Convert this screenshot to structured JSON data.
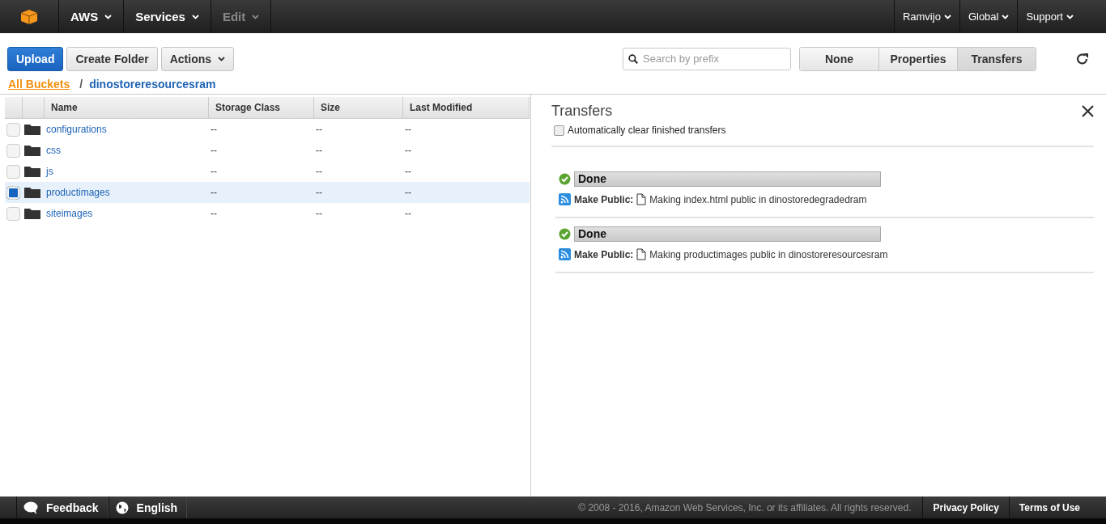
{
  "top_nav": {
    "left": [
      {
        "label": "AWS",
        "disabled": false
      },
      {
        "label": "Services",
        "disabled": false
      },
      {
        "label": "Edit",
        "disabled": true
      }
    ],
    "right": [
      "Ramvijo",
      "Global",
      "Support"
    ]
  },
  "toolbar": {
    "buttons": [
      {
        "label": "Upload",
        "kind": "primary"
      },
      {
        "label": "Create Folder",
        "kind": "plain"
      },
      {
        "label": "Actions",
        "kind": "menu"
      }
    ],
    "search": {
      "placeholder": "Search by prefix"
    },
    "views": [
      {
        "label": "None",
        "selected": false
      },
      {
        "label": "Properties",
        "selected": false
      },
      {
        "label": "Transfers",
        "selected": true
      }
    ]
  },
  "breadcrumb": {
    "root": "All Buckets",
    "separator": "/",
    "current": "dinostoreresourcesram"
  },
  "table": {
    "columns": [
      "Name",
      "Storage Class",
      "Size",
      "Last Modified"
    ],
    "rows": [
      {
        "name": "configurations",
        "storage_class": "--",
        "size": "--",
        "last_modified": "--",
        "selected": false
      },
      {
        "name": "css",
        "storage_class": "--",
        "size": "--",
        "last_modified": "--",
        "selected": false
      },
      {
        "name": "js",
        "storage_class": "--",
        "size": "--",
        "last_modified": "--",
        "selected": false
      },
      {
        "name": "productimages",
        "storage_class": "--",
        "size": "--",
        "last_modified": "--",
        "selected": true
      },
      {
        "name": "siteimages",
        "storage_class": "--",
        "size": "--",
        "last_modified": "--",
        "selected": false
      }
    ]
  },
  "transfers": {
    "title": "Transfers",
    "auto_clear": {
      "label": "Automatically clear finished transfers",
      "checked": false
    },
    "items": [
      {
        "status": "Done",
        "level": 1,
        "action": "Make Public:",
        "detail": "Making index.html public in dinostoredegradedram"
      },
      {
        "status": "Done",
        "level": 1,
        "action": "Make Public:",
        "detail": "Making productimages public in dinostoreresourcesram"
      }
    ]
  },
  "footer": {
    "left": [
      "Feedback",
      "English"
    ],
    "copyright": "© 2008 - 2016, Amazon Web Services, Inc. or its affiliates. All rights reserved.",
    "links": [
      "Privacy Policy",
      "Terms of Use"
    ]
  }
}
